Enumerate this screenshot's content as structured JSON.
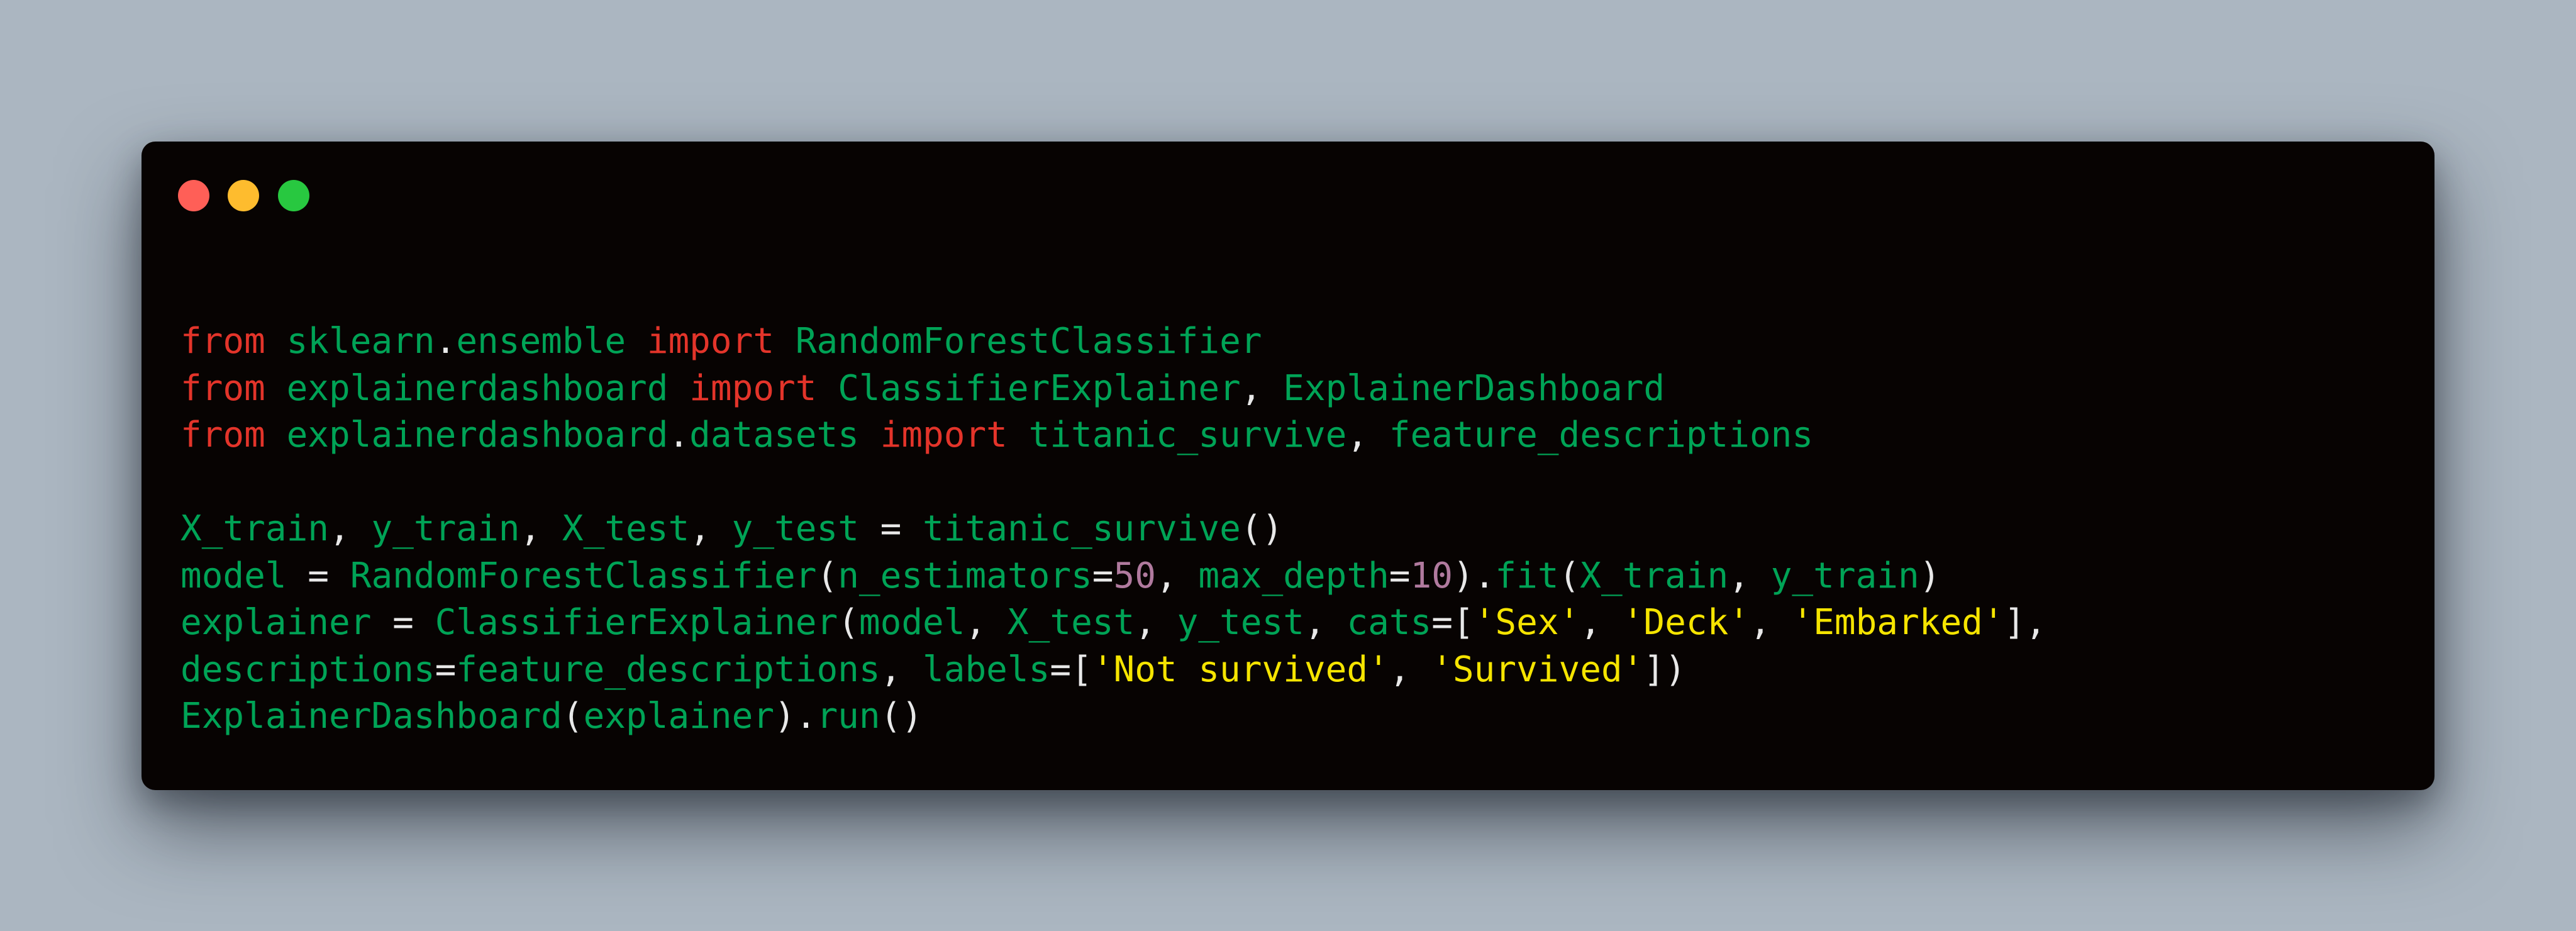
{
  "colors": {
    "keyword": "#e3342a",
    "identifier": "#00a356",
    "punctuation": "#e8e8e8",
    "number": "#b07a9e",
    "string": "#f5e400",
    "window_bg": "#070302",
    "page_bg": "#abb6c1"
  },
  "window_controls": [
    {
      "name": "close",
      "color": "#ff5f57"
    },
    {
      "name": "minimize",
      "color": "#febc2e"
    },
    {
      "name": "maximize",
      "color": "#28c840"
    }
  ],
  "code_lines": [
    [
      [
        "kw",
        "from"
      ],
      [
        "p",
        " "
      ],
      [
        "id",
        "sklearn"
      ],
      [
        "p",
        "."
      ],
      [
        "id",
        "ensemble"
      ],
      [
        "p",
        " "
      ],
      [
        "kw",
        "import"
      ],
      [
        "p",
        " "
      ],
      [
        "id",
        "RandomForestClassifier"
      ]
    ],
    [
      [
        "kw",
        "from"
      ],
      [
        "p",
        " "
      ],
      [
        "id",
        "explainerdashboard"
      ],
      [
        "p",
        " "
      ],
      [
        "kw",
        "import"
      ],
      [
        "p",
        " "
      ],
      [
        "id",
        "ClassifierExplainer"
      ],
      [
        "p",
        ", "
      ],
      [
        "id",
        "ExplainerDashboard"
      ]
    ],
    [
      [
        "kw",
        "from"
      ],
      [
        "p",
        " "
      ],
      [
        "id",
        "explainerdashboard"
      ],
      [
        "p",
        "."
      ],
      [
        "id",
        "datasets"
      ],
      [
        "p",
        " "
      ],
      [
        "kw",
        "import"
      ],
      [
        "p",
        " "
      ],
      [
        "id",
        "titanic_survive"
      ],
      [
        "p",
        ", "
      ],
      [
        "id",
        "feature_descriptions"
      ]
    ],
    [],
    [
      [
        "id",
        "X_train"
      ],
      [
        "p",
        ", "
      ],
      [
        "id",
        "y_train"
      ],
      [
        "p",
        ", "
      ],
      [
        "id",
        "X_test"
      ],
      [
        "p",
        ", "
      ],
      [
        "id",
        "y_test"
      ],
      [
        "p",
        " = "
      ],
      [
        "id",
        "titanic_survive"
      ],
      [
        "p",
        "()"
      ]
    ],
    [
      [
        "id",
        "model"
      ],
      [
        "p",
        " = "
      ],
      [
        "id",
        "RandomForestClassifier"
      ],
      [
        "p",
        "("
      ],
      [
        "id",
        "n_estimators"
      ],
      [
        "p",
        "="
      ],
      [
        "num",
        "50"
      ],
      [
        "p",
        ", "
      ],
      [
        "id",
        "max_depth"
      ],
      [
        "p",
        "="
      ],
      [
        "num",
        "10"
      ],
      [
        "p",
        ")."
      ],
      [
        "id",
        "fit"
      ],
      [
        "p",
        "("
      ],
      [
        "id",
        "X_train"
      ],
      [
        "p",
        ", "
      ],
      [
        "id",
        "y_train"
      ],
      [
        "p",
        ")"
      ]
    ],
    [
      [
        "id",
        "explainer"
      ],
      [
        "p",
        " = "
      ],
      [
        "id",
        "ClassifierExplainer"
      ],
      [
        "p",
        "("
      ],
      [
        "id",
        "model"
      ],
      [
        "p",
        ", "
      ],
      [
        "id",
        "X_test"
      ],
      [
        "p",
        ", "
      ],
      [
        "id",
        "y_test"
      ],
      [
        "p",
        ", "
      ],
      [
        "id",
        "cats"
      ],
      [
        "p",
        "=["
      ],
      [
        "str",
        "'Sex'"
      ],
      [
        "p",
        ", "
      ],
      [
        "str",
        "'Deck'"
      ],
      [
        "p",
        ", "
      ],
      [
        "str",
        "'Embarked'"
      ],
      [
        "p",
        "],"
      ]
    ],
    [
      [
        "id",
        "descriptions"
      ],
      [
        "p",
        "="
      ],
      [
        "id",
        "feature_descriptions"
      ],
      [
        "p",
        ", "
      ],
      [
        "id",
        "labels"
      ],
      [
        "p",
        "=["
      ],
      [
        "str",
        "'Not survived'"
      ],
      [
        "p",
        ", "
      ],
      [
        "str",
        "'Survived'"
      ],
      [
        "p",
        "])"
      ]
    ],
    [
      [
        "id",
        "ExplainerDashboard"
      ],
      [
        "p",
        "("
      ],
      [
        "id",
        "explainer"
      ],
      [
        "p",
        ")."
      ],
      [
        "id",
        "run"
      ],
      [
        "p",
        "()"
      ]
    ]
  ]
}
